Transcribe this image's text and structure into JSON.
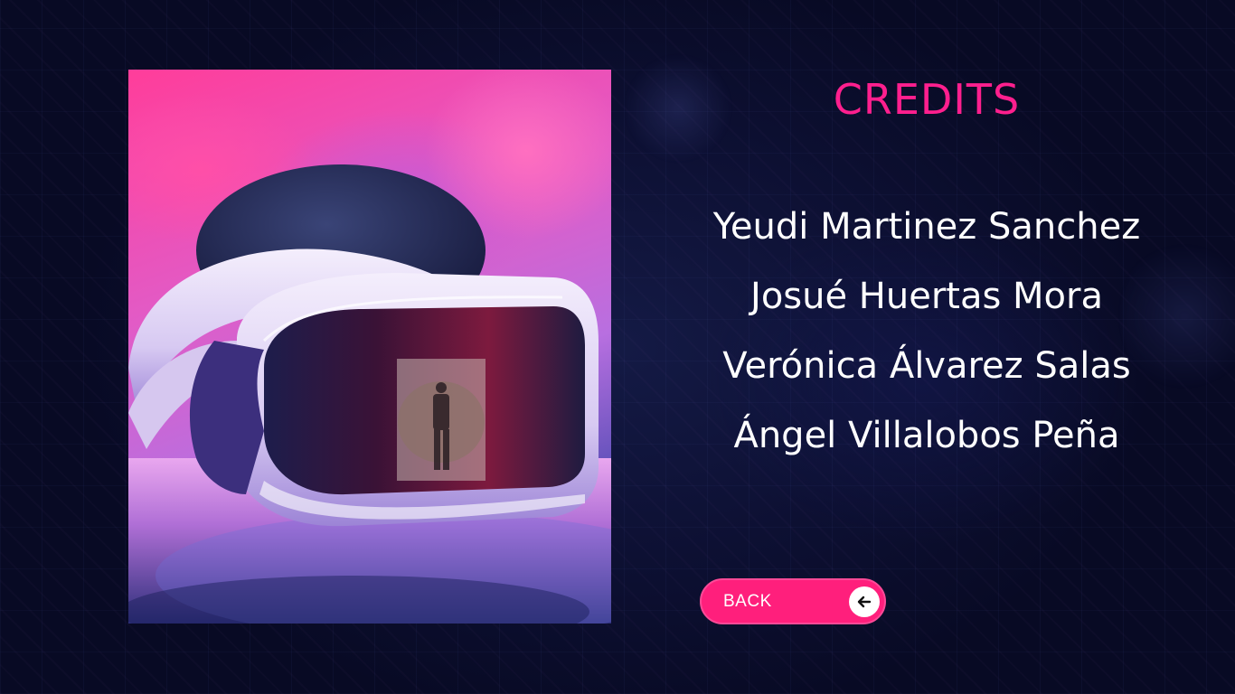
{
  "screen": {
    "title": "CREDITS",
    "credits": [
      "Yeudi Martinez Sanchez",
      "Josué Huertas Mora",
      "Verónica Álvarez Salas",
      "Ángel Villalobos Peña"
    ]
  },
  "photo": {
    "subject": "vr-headset"
  },
  "back_button": {
    "label": "BACK",
    "icon": "arrow-left-icon"
  },
  "colors": {
    "accent": "#ff1f8e",
    "button": "#ff1f7c",
    "background": "#0d1033",
    "text": "#ffffff"
  }
}
